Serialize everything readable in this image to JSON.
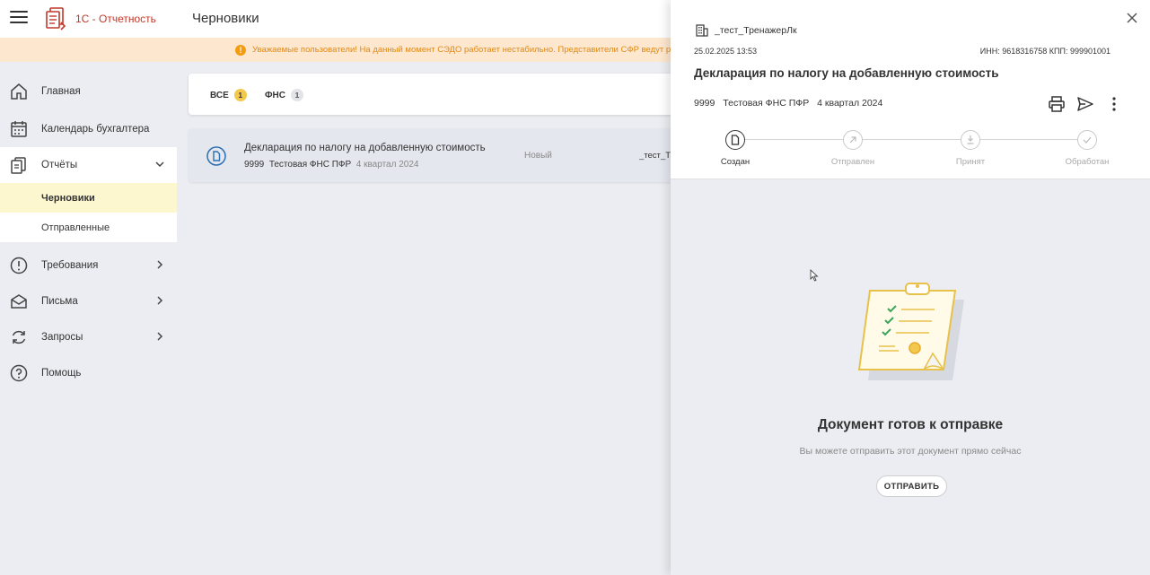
{
  "header": {
    "brand": "1С - Отчетность",
    "page_title": "Черновики"
  },
  "banner": {
    "text": "Уважаемые пользователи! На данный момент СЭДО работает нестабильно. Представители СФР ведут р"
  },
  "sidebar": {
    "items": [
      {
        "label": "Главная",
        "icon": "home-icon"
      },
      {
        "label": "Календарь бухгалтера",
        "icon": "calendar-icon"
      },
      {
        "label": "Отчёты",
        "icon": "reports-icon",
        "expanded": true
      },
      {
        "label": "Требования",
        "icon": "alert-circle-icon"
      },
      {
        "label": "Письма",
        "icon": "envelope-icon"
      },
      {
        "label": "Запросы",
        "icon": "refresh-icon"
      },
      {
        "label": "Помощь",
        "icon": "help-icon"
      }
    ],
    "subitems": [
      {
        "label": "Черновики",
        "active": true
      },
      {
        "label": "Отправленные",
        "active": false
      }
    ]
  },
  "tabs": [
    {
      "label": "ВСЕ",
      "count": "1"
    },
    {
      "label": "ФНС",
      "count": "1"
    }
  ],
  "row": {
    "title": "Декларация по налогу на добавленную стоимость",
    "code": "9999",
    "agency": "Тестовая ФНС ПФР",
    "period": "4 квартал 2024",
    "status": "Новый",
    "org": "_тест_Тр"
  },
  "panel": {
    "org_name": "_тест_ТренажерЛк",
    "date": "25.02.2025 13:53",
    "inn": "ИНН: 9618316758  КПП: 999901001",
    "title": "Декларация по налогу на добавленную стоимость",
    "code": "9999",
    "agency": "Тестовая ФНС ПФР",
    "period": "4 квартал 2024",
    "steps": [
      {
        "label": "Создан",
        "done": true
      },
      {
        "label": "Отправлен",
        "done": false
      },
      {
        "label": "Принят",
        "done": false
      },
      {
        "label": "Обработан",
        "done": false
      }
    ],
    "ready_title": "Документ готов к отправке",
    "ready_sub": "Вы можете отправить этот документ прямо сейчас",
    "send_label": "ОТПРАВИТЬ"
  },
  "colors": {
    "brand": "#c0392b",
    "banner_bg": "#fde7cf",
    "banner_text": "#e08a18",
    "active_sub_bg": "#fdf7cf",
    "badge_yellow": "#f2c94c"
  }
}
